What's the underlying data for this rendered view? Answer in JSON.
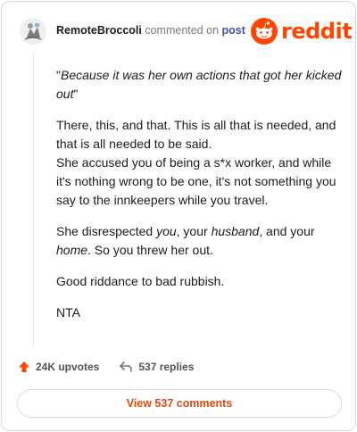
{
  "header": {
    "username": "RemoteBroccoli",
    "action_text": "commented on",
    "post_link": "post",
    "logo_text": "reddit"
  },
  "comment": {
    "quote_open": "\"",
    "quote_text": "Because it was her own actions that got her kicked out",
    "quote_close": "\"",
    "para1_line1": "There, this, and that. This is all that is needed, and that is all needed to be said.",
    "para1_line2": "She accused you of being a s*x worker, and while it's nothing wrong to be one, it's not something you say to the innkeepers while you travel.",
    "para2": {
      "t1": "She disrespected ",
      "you": "you",
      "t2": ", your ",
      "husband": "husband",
      "t3": ", and your ",
      "home": "home",
      "t4": ". So you threw her out."
    },
    "para3": "Good riddance to bad rubbish.",
    "para4": "NTA"
  },
  "footer": {
    "upvotes": "24K upvotes",
    "replies": "537 replies",
    "view_button": "View 537 comments"
  },
  "colors": {
    "brand": "#ff4500",
    "link": "#3a4fb0",
    "button_text": "#e2470d"
  }
}
